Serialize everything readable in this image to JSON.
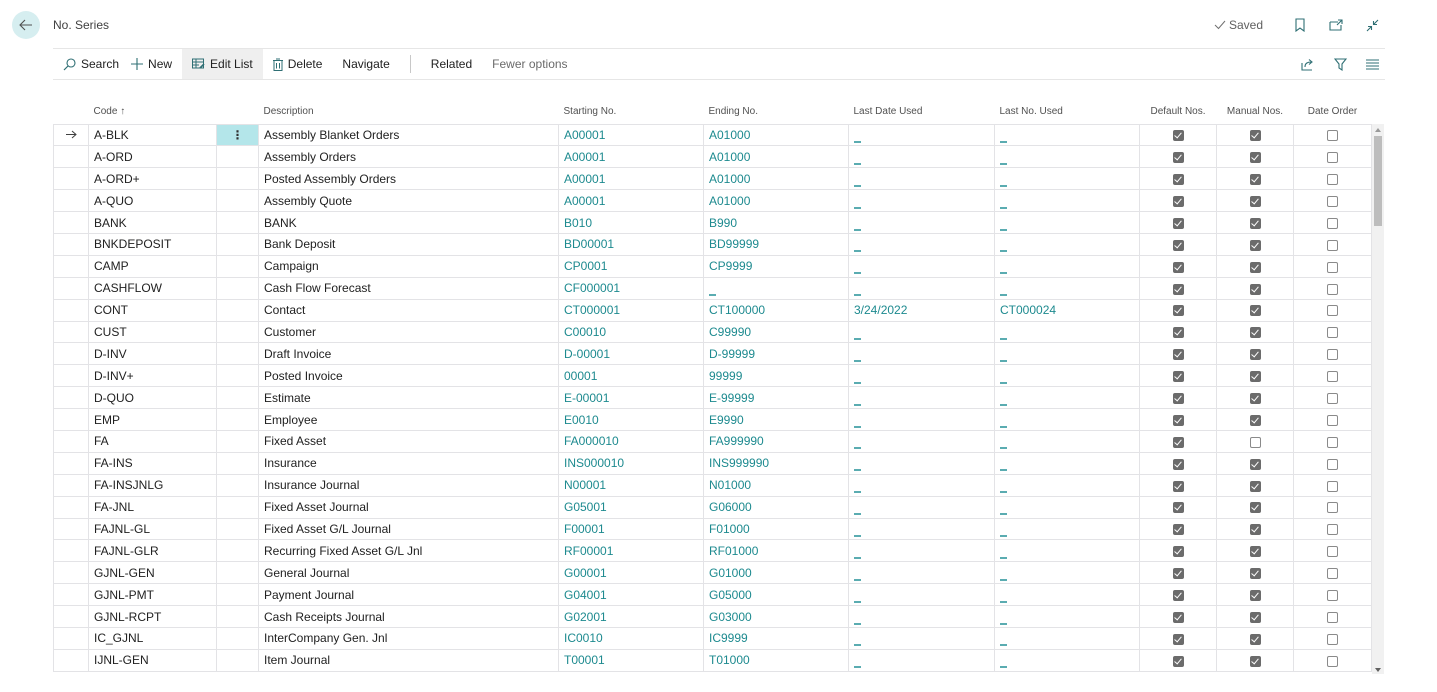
{
  "page": {
    "title": "No. Series",
    "saved_label": "Saved"
  },
  "actions": {
    "search": "Search",
    "new": "New",
    "edit_list": "Edit List",
    "delete": "Delete",
    "navigate": "Navigate",
    "related": "Related",
    "fewer_options": "Fewer options"
  },
  "columns": {
    "code": "Code",
    "code_sort": "↑",
    "description": "Description",
    "starting_no": "Starting No.",
    "ending_no": "Ending No.",
    "last_date_used": "Last Date Used",
    "last_no_used": "Last No. Used",
    "default_nos": "Default Nos.",
    "manual_nos": "Manual Nos.",
    "date_order": "Date Order"
  },
  "colors": {
    "accent": "#1d8a8f",
    "selected_cell": "#b4e6ea",
    "back_button": "#d6eef0"
  },
  "rows": [
    {
      "code": "A-BLK",
      "description": "Assembly Blanket Orders",
      "starting_no": "A00001",
      "ending_no": "A01000",
      "last_date_used": "",
      "last_no_used": "",
      "default_nos": true,
      "manual_nos": true,
      "date_order": false,
      "selected": true
    },
    {
      "code": "A-ORD",
      "description": "Assembly Orders",
      "starting_no": "A00001",
      "ending_no": "A01000",
      "last_date_used": "",
      "last_no_used": "",
      "default_nos": true,
      "manual_nos": true,
      "date_order": false
    },
    {
      "code": "A-ORD+",
      "description": "Posted Assembly Orders",
      "starting_no": "A00001",
      "ending_no": "A01000",
      "last_date_used": "",
      "last_no_used": "",
      "default_nos": true,
      "manual_nos": true,
      "date_order": false
    },
    {
      "code": "A-QUO",
      "description": "Assembly Quote",
      "starting_no": "A00001",
      "ending_no": "A01000",
      "last_date_used": "",
      "last_no_used": "",
      "default_nos": true,
      "manual_nos": true,
      "date_order": false
    },
    {
      "code": "BANK",
      "description": "BANK",
      "starting_no": "B010",
      "ending_no": "B990",
      "last_date_used": "",
      "last_no_used": "",
      "default_nos": true,
      "manual_nos": true,
      "date_order": false
    },
    {
      "code": "BNKDEPOSIT",
      "description": "Bank Deposit",
      "starting_no": "BD00001",
      "ending_no": "BD99999",
      "last_date_used": "",
      "last_no_used": "",
      "default_nos": true,
      "manual_nos": true,
      "date_order": false
    },
    {
      "code": "CAMP",
      "description": "Campaign",
      "starting_no": "CP0001",
      "ending_no": "CP9999",
      "last_date_used": "",
      "last_no_used": "",
      "default_nos": true,
      "manual_nos": true,
      "date_order": false
    },
    {
      "code": "CASHFLOW",
      "description": "Cash Flow Forecast",
      "starting_no": "CF000001",
      "ending_no": "",
      "last_date_used": "",
      "last_no_used": "",
      "default_nos": true,
      "manual_nos": true,
      "date_order": false
    },
    {
      "code": "CONT",
      "description": "Contact",
      "starting_no": "CT000001",
      "ending_no": "CT100000",
      "last_date_used": "3/24/2022",
      "last_no_used": "CT000024",
      "default_nos": true,
      "manual_nos": true,
      "date_order": false
    },
    {
      "code": "CUST",
      "description": "Customer",
      "starting_no": "C00010",
      "ending_no": "C99990",
      "last_date_used": "",
      "last_no_used": "",
      "default_nos": true,
      "manual_nos": true,
      "date_order": false
    },
    {
      "code": "D-INV",
      "description": "Draft Invoice",
      "starting_no": "D-00001",
      "ending_no": "D-99999",
      "last_date_used": "",
      "last_no_used": "",
      "default_nos": true,
      "manual_nos": true,
      "date_order": false
    },
    {
      "code": "D-INV+",
      "description": "Posted Invoice",
      "starting_no": "00001",
      "ending_no": "99999",
      "last_date_used": "",
      "last_no_used": "",
      "default_nos": true,
      "manual_nos": true,
      "date_order": false
    },
    {
      "code": "D-QUO",
      "description": "Estimate",
      "starting_no": "E-00001",
      "ending_no": "E-99999",
      "last_date_used": "",
      "last_no_used": "",
      "default_nos": true,
      "manual_nos": true,
      "date_order": false
    },
    {
      "code": "EMP",
      "description": "Employee",
      "starting_no": "E0010",
      "ending_no": "E9990",
      "last_date_used": "",
      "last_no_used": "",
      "default_nos": true,
      "manual_nos": true,
      "date_order": false
    },
    {
      "code": "FA",
      "description": "Fixed Asset",
      "starting_no": "FA000010",
      "ending_no": "FA999990",
      "last_date_used": "",
      "last_no_used": "",
      "default_nos": true,
      "manual_nos": false,
      "date_order": false
    },
    {
      "code": "FA-INS",
      "description": "Insurance",
      "starting_no": "INS000010",
      "ending_no": "INS999990",
      "last_date_used": "",
      "last_no_used": "",
      "default_nos": true,
      "manual_nos": true,
      "date_order": false
    },
    {
      "code": "FA-INSJNLG",
      "description": "Insurance Journal",
      "starting_no": "N00001",
      "ending_no": "N01000",
      "last_date_used": "",
      "last_no_used": "",
      "default_nos": true,
      "manual_nos": true,
      "date_order": false
    },
    {
      "code": "FA-JNL",
      "description": "Fixed Asset Journal",
      "starting_no": "G05001",
      "ending_no": "G06000",
      "last_date_used": "",
      "last_no_used": "",
      "default_nos": true,
      "manual_nos": true,
      "date_order": false
    },
    {
      "code": "FAJNL-GL",
      "description": "Fixed Asset G/L Journal",
      "starting_no": "F00001",
      "ending_no": "F01000",
      "last_date_used": "",
      "last_no_used": "",
      "default_nos": true,
      "manual_nos": true,
      "date_order": false
    },
    {
      "code": "FAJNL-GLR",
      "description": "Recurring Fixed Asset G/L Jnl",
      "starting_no": "RF00001",
      "ending_no": "RF01000",
      "last_date_used": "",
      "last_no_used": "",
      "default_nos": true,
      "manual_nos": true,
      "date_order": false
    },
    {
      "code": "GJNL-GEN",
      "description": "General Journal",
      "starting_no": "G00001",
      "ending_no": "G01000",
      "last_date_used": "",
      "last_no_used": "",
      "default_nos": true,
      "manual_nos": true,
      "date_order": false
    },
    {
      "code": "GJNL-PMT",
      "description": "Payment Journal",
      "starting_no": "G04001",
      "ending_no": "G05000",
      "last_date_used": "",
      "last_no_used": "",
      "default_nos": true,
      "manual_nos": true,
      "date_order": false
    },
    {
      "code": "GJNL-RCPT",
      "description": "Cash Receipts Journal",
      "starting_no": "G02001",
      "ending_no": "G03000",
      "last_date_used": "",
      "last_no_used": "",
      "default_nos": true,
      "manual_nos": true,
      "date_order": false
    },
    {
      "code": "IC_GJNL",
      "description": "InterCompany Gen. Jnl",
      "starting_no": "IC0010",
      "ending_no": "IC9999",
      "last_date_used": "",
      "last_no_used": "",
      "default_nos": true,
      "manual_nos": true,
      "date_order": false
    },
    {
      "code": "IJNL-GEN",
      "description": "Item Journal",
      "starting_no": "T00001",
      "ending_no": "T01000",
      "last_date_used": "",
      "last_no_used": "",
      "default_nos": true,
      "manual_nos": true,
      "date_order": false
    }
  ]
}
